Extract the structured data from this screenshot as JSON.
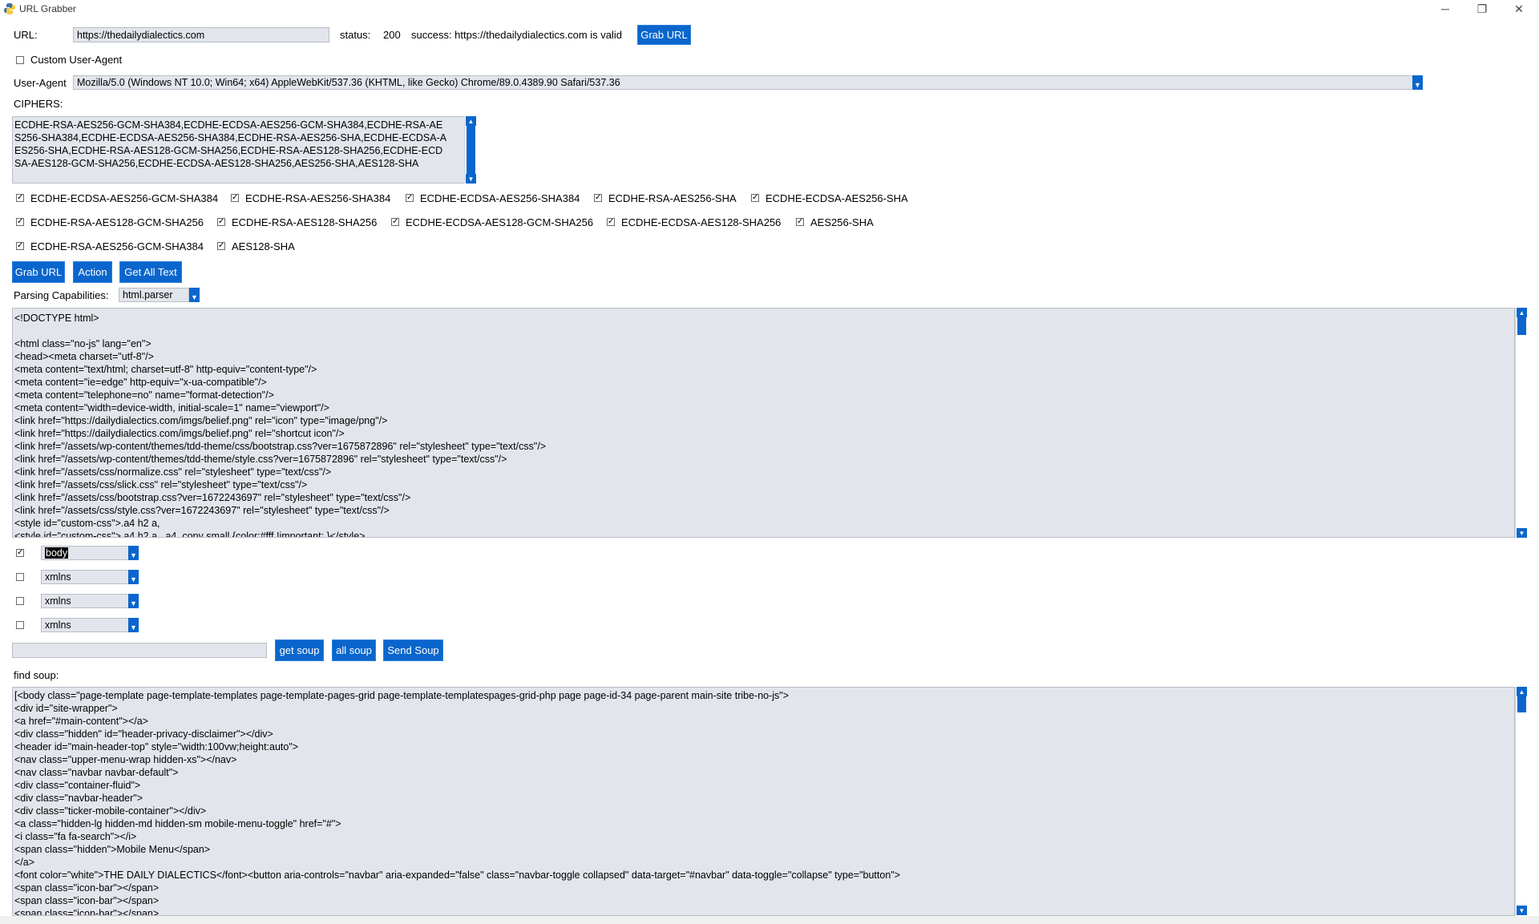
{
  "window": {
    "title": "URL Grabber",
    "minimize_glyph": "─",
    "maximize_glyph": "❐",
    "close_glyph": "✕",
    "app_icon": "python-icon"
  },
  "url_row": {
    "label": "URL:",
    "value": "https://thedailydialectics.com",
    "status_label": "status:",
    "status_code": "200",
    "message": "success: https://thedailydialectics.com is valid",
    "grab_button": "Grab URL"
  },
  "custom_user_agent": {
    "label": "Custom User-Agent",
    "checked": false
  },
  "user_agent": {
    "label": "User-Agent",
    "value": "Mozilla/5.0 (Windows NT 10.0; Win64; x64) AppleWebKit/537.36 (KHTML, like Gecko) Chrome/89.0.4389.90 Safari/537.36"
  },
  "ciphers": {
    "label": "CIPHERS:",
    "text": "ECDHE-RSA-AES256-GCM-SHA384,ECDHE-ECDSA-AES256-GCM-SHA384,ECDHE-RSA-AE\nS256-SHA384,ECDHE-ECDSA-AES256-SHA384,ECDHE-RSA-AES256-SHA,ECDHE-ECDSA-A\nES256-SHA,ECDHE-RSA-AES128-GCM-SHA256,ECDHE-RSA-AES128-SHA256,ECDHE-ECD\nSA-AES128-GCM-SHA256,ECDHE-ECDSA-AES128-SHA256,AES256-SHA,AES128-SHA",
    "rows": [
      [
        "ECDHE-ECDSA-AES256-GCM-SHA384",
        "ECDHE-RSA-AES256-SHA384",
        "ECDHE-ECDSA-AES256-SHA384",
        "ECDHE-RSA-AES256-SHA",
        "ECDHE-ECDSA-AES256-SHA"
      ],
      [
        "ECDHE-RSA-AES128-GCM-SHA256",
        "ECDHE-RSA-AES128-SHA256",
        "ECDHE-ECDSA-AES128-GCM-SHA256",
        "ECDHE-ECDSA-AES128-SHA256",
        "AES256-SHA"
      ],
      [
        "ECDHE-RSA-AES256-GCM-SHA384",
        "AES128-SHA"
      ]
    ],
    "check_glyph": "✓"
  },
  "actions": {
    "grab_url": "Grab URL",
    "action": "Action",
    "get_all_text": "Get All Text"
  },
  "parsing": {
    "label": "Parsing Capabilities:",
    "value": "html.parser"
  },
  "source_text": "<!DOCTYPE html>\n\n<html class=\"no-js\" lang=\"en\">\n<head><meta charset=\"utf-8\"/>\n<meta content=\"text/html; charset=utf-8\" http-equiv=\"content-type\"/>\n<meta content=\"ie=edge\" http-equiv=\"x-ua-compatible\"/>\n<meta content=\"telephone=no\" name=\"format-detection\"/>\n<meta content=\"width=device-width, initial-scale=1\" name=\"viewport\"/>\n<link href=\"https://dailydialectics.com/imgs/belief.png\" rel=\"icon\" type=\"image/png\"/>\n<link href=\"https://dailydialectics.com/imgs/belief.png\" rel=\"shortcut icon\"/>\n<link href=\"/assets/wp-content/themes/tdd-theme/css/bootstrap.css?ver=1675872896\" rel=\"stylesheet\" type=\"text/css\"/>\n<link href=\"/assets/wp-content/themes/tdd-theme/style.css?ver=1675872896\" rel=\"stylesheet\" type=\"text/css\"/>\n<link href=\"/assets/css/normalize.css\" rel=\"stylesheet\" type=\"text/css\"/>\n<link href=\"/assets/css/slick.css\" rel=\"stylesheet\" type=\"text/css\"/>\n<link href=\"/assets/css/bootstrap.css?ver=1672243697\" rel=\"stylesheet\" type=\"text/css\"/>\n<link href=\"/assets/css/style.css?ver=1672243697\" rel=\"stylesheet\" type=\"text/css\"/>\n<style id=\"custom-css\">.a4 h2 a,\n<style id=\"custom-css\">.a4 h2 a, .a4 .copy small {color:#fff !important; }</style>",
  "filters": [
    {
      "checked": true,
      "value": "body",
      "selected": true
    },
    {
      "checked": false,
      "value": "xmlns",
      "selected": false
    },
    {
      "checked": false,
      "value": "xmlns",
      "selected": false
    },
    {
      "checked": false,
      "value": "xmlns",
      "selected": false
    }
  ],
  "soup_row": {
    "input_value": "",
    "get_soup": "get soup",
    "all_soup": "all soup",
    "send_soup": "Send Soup"
  },
  "find_soup": {
    "label": "find soup:",
    "text": "[<body class=\"page-template page-template-templates page-template-pages-grid page-template-templatespages-grid-php page page-id-34 page-parent main-site tribe-no-js\">\n<div id=\"site-wrapper\">\n<a href=\"#main-content\"></a>\n<div class=\"hidden\" id=\"header-privacy-disclaimer\"></div>\n<header id=\"main-header-top\" style=\"width:100vw;height:auto\">\n<nav class=\"upper-menu-wrap hidden-xs\"></nav>\n<nav class=\"navbar navbar-default\">\n<div class=\"container-fluid\">\n<div class=\"navbar-header\">\n<div class=\"ticker-mobile-container\"></div>\n<a class=\"hidden-lg hidden-md hidden-sm mobile-menu-toggle\" href=\"#\">\n<i class=\"fa fa-search\"></i>\n<span class=\"hidden\">Mobile Menu</span>\n</a>\n<font color=\"white\">THE DAILY DIALECTICS</font><button aria-controls=\"navbar\" aria-expanded=\"false\" class=\"navbar-toggle collapsed\" data-target=\"#navbar\" data-toggle=\"collapse\" type=\"button\">\n<span class=\"icon-bar\"></span>\n<span class=\"icon-bar\"></span>\n<span class=\"icon-bar\"></span>"
  },
  "colors": {
    "accent": "#0a66cc",
    "field_bg": "#e2e6ec",
    "window_bg": "#ffffff"
  }
}
